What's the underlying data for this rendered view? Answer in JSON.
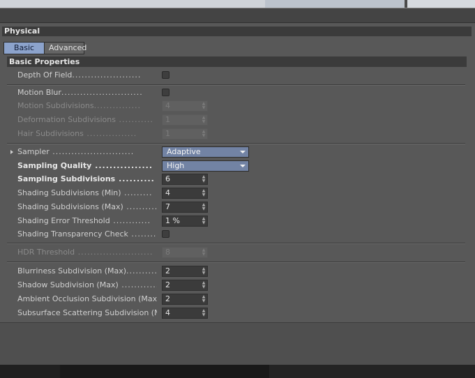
{
  "colors": {
    "accent": "#8ca3cc",
    "dropdown": "#7283a4",
    "panel": "#585858"
  },
  "section": {
    "title": "Physical"
  },
  "tabs": [
    {
      "label": "Basic",
      "active": true
    },
    {
      "label": "Advanced",
      "active": false
    }
  ],
  "basic_properties": {
    "title": "Basic Properties"
  },
  "fields": {
    "depth_of_field": {
      "label": "Depth Of Field",
      "checked": false
    },
    "motion_blur": {
      "label": "Motion Blur",
      "checked": false
    },
    "motion_subdivisions": {
      "label": "Motion Subdivisions",
      "value": "4",
      "enabled": false
    },
    "deformation_subdivisions": {
      "label": "Deformation Subdivisions",
      "value": "1",
      "enabled": false
    },
    "hair_subdivisions": {
      "label": "Hair Subdivisions",
      "value": "1",
      "enabled": false
    },
    "sampler": {
      "label": "Sampler",
      "value": "Adaptive"
    },
    "sampling_quality": {
      "label": "Sampling Quality",
      "value": "High"
    },
    "sampling_subdivisions": {
      "label": "Sampling Subdivisions",
      "value": "6"
    },
    "shading_subdivisions_min": {
      "label": "Shading Subdivisions (Min)",
      "value": "4"
    },
    "shading_subdivisions_max": {
      "label": "Shading Subdivisions (Max)",
      "value": "7"
    },
    "shading_error_threshold": {
      "label": "Shading Error Threshold",
      "value": "1 %"
    },
    "shading_transparency_check": {
      "label": "Shading Transparency Check",
      "checked": false
    },
    "hdr_threshold": {
      "label": "HDR Threshold",
      "value": "8",
      "enabled": false
    },
    "blurriness_subdivision_max": {
      "label": "Blurriness Subdivision (Max)",
      "value": "2"
    },
    "shadow_subdivision_max": {
      "label": "Shadow Subdivision (Max)",
      "value": "2"
    },
    "ambient_occlusion_subdivision_max": {
      "label": "Ambient Occlusion Subdivision (Max)",
      "value": "2"
    },
    "subsurface_scattering_subdivision_max": {
      "label": "Subsurface Scattering Subdivision (Max)",
      "value": "4"
    }
  }
}
